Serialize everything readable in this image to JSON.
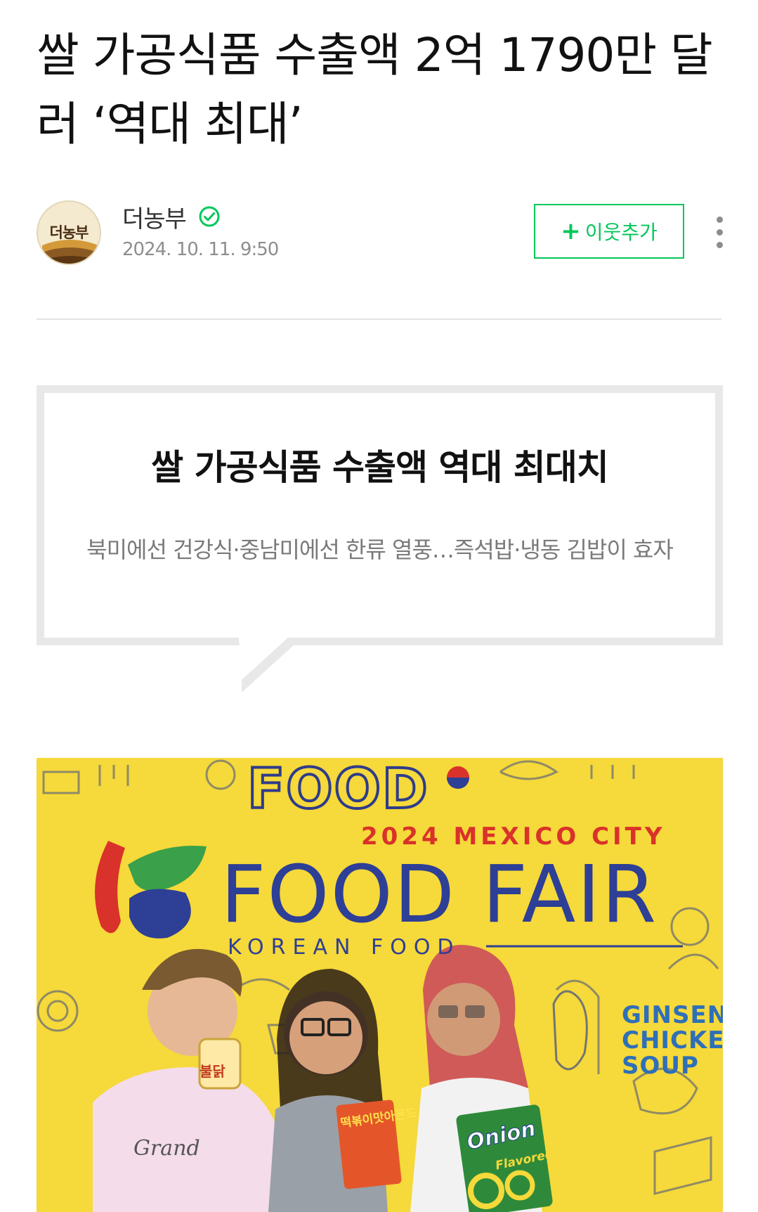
{
  "article": {
    "title": "쌀 가공식품 수출액 2억 1790만 달러 ‘역대 최대’"
  },
  "author": {
    "avatar_label": "더농부",
    "name": "더농부",
    "verified_icon": "check-circle-icon",
    "date": "2024. 10. 11. 9:50",
    "follow_plus": "+",
    "follow_label": "이웃추가",
    "more_icon": "more-vertical-icon",
    "accent_color": "#03c75a"
  },
  "quote": {
    "title": "쌀 가공식품 수출액 역대 최대치",
    "subtitle": "북미에선 건강식·중남미에선 한류 열풍…즉석밥·냉동 김밥이 효자"
  },
  "photo": {
    "food_top": "FOOD",
    "city": "2024 MEXICO CITY",
    "fair": "FOOD FAIR",
    "korean": "KOREAN FOOD",
    "ginseng": "GINSENG CHICKEN SOUP",
    "onion": "Onion",
    "rings": "Flavored Rings",
    "snack": "떡볶이맛아몬드",
    "cup": "불닭",
    "shirt": "Grand"
  }
}
